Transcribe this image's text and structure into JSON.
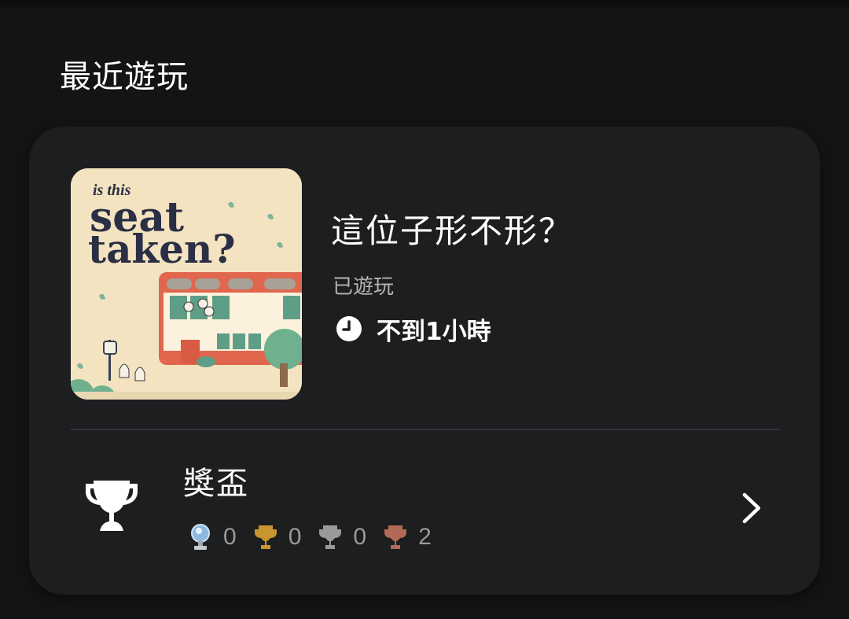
{
  "section": {
    "title": "最近遊玩"
  },
  "game": {
    "cover_text": {
      "line1": "is this",
      "line2": "seat",
      "line3": "taken?"
    },
    "title": "這位子形不形？",
    "played_label": "已遊玩",
    "time_icon": "clock-icon",
    "playtime": "不到1小時"
  },
  "trophies": {
    "icon": "trophy-icon",
    "label": "獎盃",
    "platinum": "0",
    "gold": "0",
    "silver": "0",
    "bronze": "2",
    "colors": {
      "platinum": "#8fb8e0",
      "gold": "#c9952e",
      "silver": "#9a9a9a",
      "bronze": "#b06a55"
    },
    "chevron_icon": "chevron-right-icon"
  }
}
